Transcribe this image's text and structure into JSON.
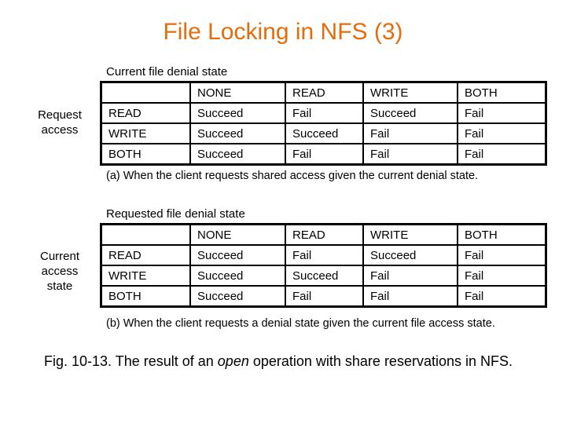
{
  "title": "File Locking in NFS (3)",
  "table_a": {
    "top_label": "Current file denial state",
    "side_label": [
      "Request",
      "access"
    ],
    "columns": [
      "",
      "NONE",
      "READ",
      "WRITE",
      "BOTH"
    ],
    "rows": [
      [
        "READ",
        "Succeed",
        "Fail",
        "Succeed",
        "Fail"
      ],
      [
        "WRITE",
        "Succeed",
        "Succeed",
        "Fail",
        "Fail"
      ],
      [
        "BOTH",
        "Succeed",
        "Fail",
        "Fail",
        "Fail"
      ]
    ],
    "caption": "(a)  When the client requests shared access given the current denial state."
  },
  "table_b": {
    "top_label": "Requested file denial state",
    "side_label": [
      "Current",
      "access",
      "state"
    ],
    "columns": [
      "",
      "NONE",
      "READ",
      "WRITE",
      "BOTH"
    ],
    "rows": [
      [
        "READ",
        "Succeed",
        "Fail",
        "Succeed",
        "Fail"
      ],
      [
        "WRITE",
        "Succeed",
        "Succeed",
        "Fail",
        "Fail"
      ],
      [
        "BOTH",
        "Succeed",
        "Fail",
        "Fail",
        "Fail"
      ]
    ],
    "caption": "(b) When the client requests a denial state given the current file access state."
  },
  "figure_caption": {
    "prefix": "Fig. 10-13. The result of an ",
    "italic": "open",
    "suffix": " operation with share reservations in NFS."
  },
  "colors": {
    "title": "#e46c0a"
  }
}
